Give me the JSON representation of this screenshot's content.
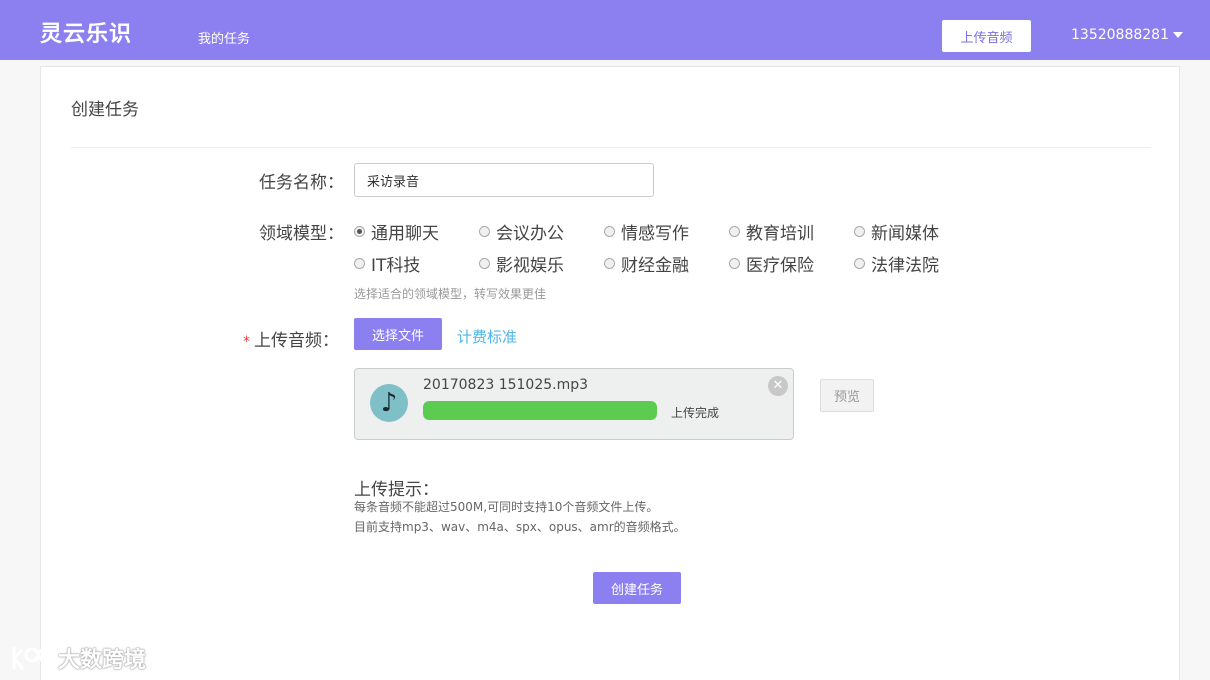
{
  "header": {
    "logo": "灵云乐识",
    "nav_my_tasks": "我的任务",
    "upload_audio_button": "上传音频",
    "username": "13520888281"
  },
  "form": {
    "title": "创建任务",
    "task_name_label": "任务名称：",
    "task_name_value": "采访录音",
    "domain_model_label": "领域模型：",
    "domain_options": [
      "通用聊天",
      "会议办公",
      "情感写作",
      "教育培训",
      "新闻媒体",
      "IT科技",
      "影视娱乐",
      "财经金融",
      "医疗保险",
      "法律法院"
    ],
    "domain_selected": "通用聊天",
    "domain_hint": "选择适合的领域模型，转写效果更佳",
    "required_star": "*",
    "upload_label": "上传音频：",
    "select_file_button": "选择文件",
    "pricing_link": "计费标准",
    "file": {
      "name": "20170823 151025.mp3",
      "progress": 1.0,
      "status": "上传完成"
    },
    "preview_button": "预览",
    "tips_title": "上传提示：",
    "tips_line1": "每条音频不能超过500M,可同时支持10个音频文件上传。",
    "tips_line2": "目前支持mp3、wav、m4a、spx、opus、amr的音频格式。",
    "create_button": "创建任务"
  },
  "watermark": {
    "text": "大数跨境"
  },
  "colors": {
    "brand": "#8c80f0",
    "progress": "#5ccc50",
    "link": "#4db6e8",
    "required": "#ee3333"
  }
}
